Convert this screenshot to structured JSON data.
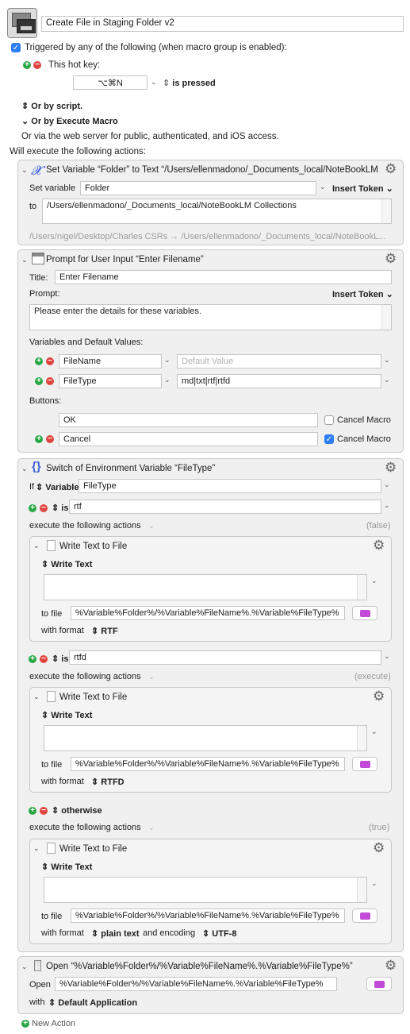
{
  "macro": {
    "name": "Create File in Staging Folder v2",
    "trigger_enabled_label": "Triggered by any of the following (when macro group is enabled):",
    "hotkey_label": "This hot key:",
    "hotkey_value": "⌥⌘N",
    "hotkey_state": "is pressed",
    "or_by_script": "Or by script.",
    "or_by_execute_macro": "Or by Execute Macro",
    "web_server_text": "Or via the web server for public, authenticated, and iOS access.",
    "will_execute": "Will execute the following actions:",
    "new_action": "New Action"
  },
  "actions": {
    "set_variable": {
      "title": "Set Variable “Folder” to Text “/Users/ellenmadono/_Documents_local/NoteBookLM...",
      "set_label": "Set variable",
      "variable_name": "Folder",
      "insert_token": "Insert Token",
      "to_label": "to",
      "text_value": "/Users/ellenmadono/_Documents_local/NoteBookLM Collections",
      "preview": "/Users/nigel/Desktop/Charles CSRs → /Users/ellenmadono/_Documents_local/NoteBookL..."
    },
    "prompt": {
      "title": "Prompt for User Input “Enter Filename”",
      "title_label": "Title:",
      "title_value": "Enter Filename",
      "prompt_label": "Prompt:",
      "insert_token": "Insert Token",
      "prompt_text": "Please enter the details for these variables.",
      "vars_label": "Variables and Default Values:",
      "variables": [
        {
          "name": "FileName",
          "default": "",
          "placeholder": "Default Value"
        },
        {
          "name": "FileType",
          "default": "md|txt|rtf|rtfd",
          "placeholder": ""
        }
      ],
      "buttons_label": "Buttons:",
      "buttons": [
        {
          "name": "OK",
          "cancel_label": "Cancel Macro",
          "cancel_checked": false
        },
        {
          "name": "Cancel",
          "cancel_label": "Cancel Macro",
          "cancel_checked": true
        }
      ]
    },
    "switch": {
      "title": "Switch of Environment Variable “FileType”",
      "if_label": "If",
      "source_type": "Variable",
      "source_name": "FileType",
      "cases": [
        {
          "condition": "is",
          "value": "rtf",
          "execute_label": "execute the following actions",
          "result": "(false)",
          "write_title": "Write Text to File",
          "write_text_label": "Write Text",
          "to_file_label": "to file",
          "path": "%Variable%Folder%/%Variable%FileName%.%Variable%FileType%",
          "format_label": "with format",
          "format": "RTF",
          "encoding_label": "",
          "encoding": ""
        },
        {
          "condition": "is",
          "value": "rtfd",
          "execute_label": "execute the following actions",
          "result": "(execute)",
          "write_title": "Write Text to File",
          "write_text_label": "Write Text",
          "to_file_label": "to file",
          "path": "%Variable%Folder%/%Variable%FileName%.%Variable%FileType%",
          "format_label": "with format",
          "format": "RTFD",
          "encoding_label": "",
          "encoding": ""
        },
        {
          "condition": "otherwise",
          "value": "",
          "execute_label": "execute the following actions",
          "result": "(true)",
          "write_title": "Write Text to File",
          "write_text_label": "Write Text",
          "to_file_label": "to file",
          "path": "%Variable%Folder%/%Variable%FileName%.%Variable%FileType%",
          "format_label": "with format",
          "format": "plain text",
          "encoding_label": "and encoding",
          "encoding": "UTF-8"
        }
      ]
    },
    "open": {
      "title": "Open “%Variable%Folder%/%Variable%FileName%.%Variable%FileType%”",
      "open_label": "Open",
      "path": "%Variable%Folder%/%Variable%FileName%.%Variable%FileType%",
      "with_label": "with",
      "app": "Default Application"
    }
  },
  "colors": {
    "plus": "#28a745",
    "minus": "#e0443e",
    "checkbox_on": "#2c7df6",
    "folder_button": "#c14bd6",
    "variable_icon": "#3b5fd9"
  },
  "icons": [
    "macro-icon",
    "plus-icon",
    "minus-icon",
    "gear-icon",
    "variable-x-icon",
    "window-icon",
    "braces-icon",
    "document-icon",
    "folder-icon",
    "file-open-icon",
    "chevron-down-icon",
    "updown-icon",
    "disclosure-triangle-icon",
    "arrow-right-icon"
  ]
}
